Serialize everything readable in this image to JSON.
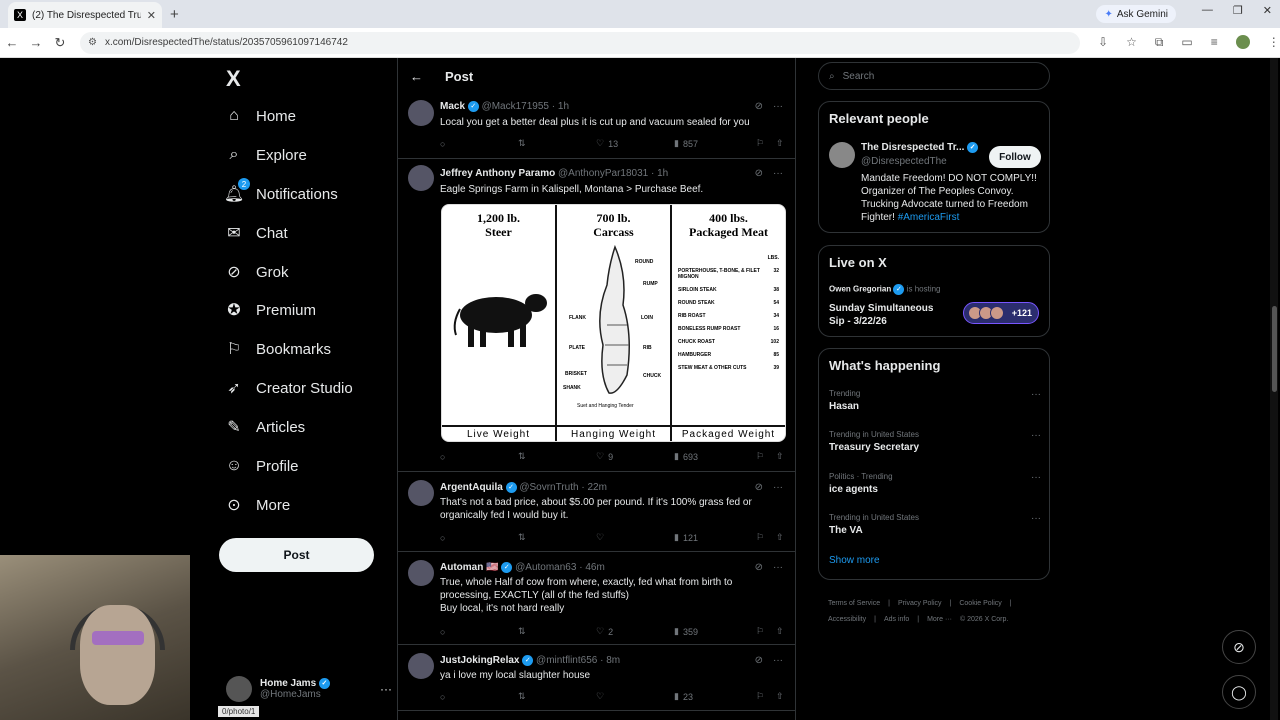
{
  "browser": {
    "tab_title": "(2) The Disrespected Trucker on",
    "tab_favicon": "X",
    "url": "x.com/DisrespectedThe/status/2035705961097146742",
    "gemini_label": "Ask Gemini",
    "status_url": "0/photo/1"
  },
  "nav": {
    "logo": "X",
    "items": [
      {
        "label": "Home",
        "icon": "home-icon"
      },
      {
        "label": "Explore",
        "icon": "search-icon"
      },
      {
        "label": "Notifications",
        "icon": "bell-icon",
        "badge": "2"
      },
      {
        "label": "Chat",
        "icon": "mail-icon"
      },
      {
        "label": "Grok",
        "icon": "grok-icon"
      },
      {
        "label": "Premium",
        "icon": "premium-icon"
      },
      {
        "label": "Bookmarks",
        "icon": "bookmark-icon"
      },
      {
        "label": "Creator Studio",
        "icon": "rocket-icon"
      },
      {
        "label": "Articles",
        "icon": "article-icon"
      },
      {
        "label": "Profile",
        "icon": "person-icon"
      },
      {
        "label": "More",
        "icon": "more-circle-icon"
      }
    ],
    "post_button": "Post",
    "account": {
      "name": "Home Jams",
      "handle": "@HomeJams",
      "more": "···"
    }
  },
  "main": {
    "title": "Post",
    "tweets": [
      {
        "name": "Mack",
        "handle": "@Mack171955",
        "time": "· 1h",
        "text": "Local you get a better deal plus it is cut up and vacuum sealed for you",
        "replies": "",
        "reposts": "",
        "likes": "13",
        "views": "857"
      },
      {
        "name": "Jeffrey Anthony Paramo",
        "handle": "@AnthonyPar18031",
        "time": "· 1h",
        "text": "Eagle Springs Farm in Kalispell, Montana > Purchase Beef.",
        "replies": "",
        "reposts": "",
        "likes": "9",
        "views": "693"
      },
      {
        "name": "ArgentAquila",
        "handle": "@SovrnTruth",
        "time": "· 22m",
        "text": "That's not a bad price, about $5.00 per pound.  If it's 100% grass fed or organically fed I would buy it.",
        "replies": "",
        "reposts": "",
        "likes": "",
        "views": "121"
      },
      {
        "name": "Automan 🇺🇸",
        "handle": "@Automan63",
        "time": "· 46m",
        "text": "True, whole Half of cow from where, exactly, fed what from birth to processing, EXACTLY (all of the fed stuffs)\nBuy local, it's not hard really",
        "replies": "",
        "reposts": "",
        "likes": "2",
        "views": "359"
      },
      {
        "name": "JustJokingRelax",
        "handle": "@mintflint656",
        "time": "· 8m",
        "text": "ya i love my local slaughter house",
        "replies": "",
        "reposts": "",
        "likes": "",
        "views": "23"
      }
    ],
    "image": {
      "panels": [
        {
          "title1": "1,200 lb.",
          "title2": "Steer",
          "caption": "Live Weight"
        },
        {
          "title1": "700 lb.",
          "title2": "Carcass",
          "caption": "Hanging Weight"
        },
        {
          "title1": "400 lbs.",
          "title2": "Packaged Meat",
          "caption": "Packaged Weight"
        }
      ],
      "carcass_labels": [
        "ROUND",
        "RUMP",
        "FLANK",
        "LOIN",
        "PLATE",
        "RIB",
        "BRISKET",
        "CHUCK",
        "SHANK",
        "Suet and Hanging Tender"
      ],
      "meat_header": "LBS.",
      "meat_rows": [
        {
          "cut": "PORTERHOUSE, T-BONE, & FILET MIGNON",
          "lbs": "32"
        },
        {
          "cut": "SIRLOIN STEAK",
          "lbs": "38"
        },
        {
          "cut": "ROUND STEAK",
          "lbs": "54"
        },
        {
          "cut": "RIB ROAST",
          "lbs": "34"
        },
        {
          "cut": "BONELESS RUMP ROAST",
          "lbs": "16"
        },
        {
          "cut": "CHUCK ROAST",
          "lbs": "102"
        },
        {
          "cut": "HAMBURGER",
          "lbs": "85"
        },
        {
          "cut": "STEW MEAT & OTHER CUTS",
          "lbs": "39"
        }
      ]
    }
  },
  "right": {
    "search_placeholder": "Search",
    "relevant": {
      "title": "Relevant people",
      "name": "The Disrespected Tr...",
      "handle": "@DisrespectedThe",
      "follow": "Follow",
      "bio": "Mandate Freedom! DO NOT COMPLY!! Organizer of The Peoples Convoy. Trucking Advocate turned to Freedom Fighter!",
      "hashtag": "#AmericaFirst"
    },
    "live": {
      "title": "Live on X",
      "host": "Owen Gregorian",
      "hosting": "is hosting",
      "space": "Sunday Simultaneous Sip - 3/22/26",
      "count": "+121"
    },
    "happening": {
      "title": "What's happening",
      "trends": [
        {
          "context": "Trending",
          "topic": "Hasan"
        },
        {
          "context": "Trending in United States",
          "topic": "Treasury Secretary"
        },
        {
          "context": "Politics · Trending",
          "topic": "ice agents"
        },
        {
          "context": "Trending in United States",
          "topic": "The VA"
        }
      ],
      "show_more": "Show more"
    },
    "footer": [
      "Terms of Service",
      "|",
      "Privacy Policy",
      "|",
      "Cookie Policy",
      "|",
      "Accessibility",
      "|",
      "Ads info",
      "|",
      "More ···",
      "© 2026 X Corp."
    ]
  }
}
